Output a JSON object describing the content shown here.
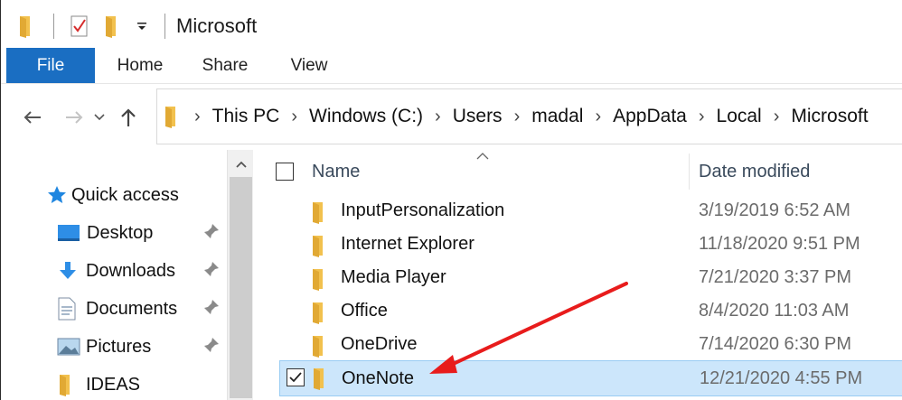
{
  "window": {
    "title": "Microsoft",
    "accent": "#1a6ec2",
    "quick_access_toolbar": [
      "folder-icon",
      "properties-check-icon",
      "new-folder-icon",
      "customize-dropdown-icon"
    ]
  },
  "ribbon": {
    "tabs": [
      {
        "label": "File",
        "active": true
      },
      {
        "label": "Home"
      },
      {
        "label": "Share"
      },
      {
        "label": "View"
      }
    ]
  },
  "address_bar": {
    "breadcrumbs": [
      "This PC",
      "Windows (C:)",
      "Users",
      "madal",
      "AppData",
      "Local",
      "Microsoft"
    ]
  },
  "nav_pane": {
    "items": [
      {
        "label": "Quick access",
        "icon": "star-icon"
      },
      {
        "label": "Desktop",
        "icon": "desktop-icon",
        "pinned": true
      },
      {
        "label": "Downloads",
        "icon": "download-arrow-icon",
        "pinned": true
      },
      {
        "label": "Documents",
        "icon": "documents-icon",
        "pinned": true
      },
      {
        "label": "Pictures",
        "icon": "pictures-icon",
        "pinned": true
      },
      {
        "label": "IDEAS",
        "icon": "folder-icon"
      }
    ]
  },
  "file_list": {
    "columns": {
      "name": "Name",
      "date": "Date modified"
    },
    "sort_column": "Name",
    "rows": [
      {
        "name": "InputPersonalization",
        "date": "3/19/2019 6:52 AM",
        "selected": false
      },
      {
        "name": "Internet Explorer",
        "date": "11/18/2020 9:51 PM",
        "selected": false
      },
      {
        "name": "Media Player",
        "date": "7/21/2020 3:37 PM",
        "selected": false
      },
      {
        "name": "Office",
        "date": "8/4/2020 11:03 AM",
        "selected": false
      },
      {
        "name": "OneDrive",
        "date": "7/14/2020 6:30 PM",
        "selected": false
      },
      {
        "name": "OneNote",
        "date": "12/21/2020 4:55 PM",
        "selected": true
      }
    ],
    "selection_color": "#cce6fb"
  },
  "annotation": {
    "color": "#e81c1c",
    "points_to": "OneNote"
  }
}
